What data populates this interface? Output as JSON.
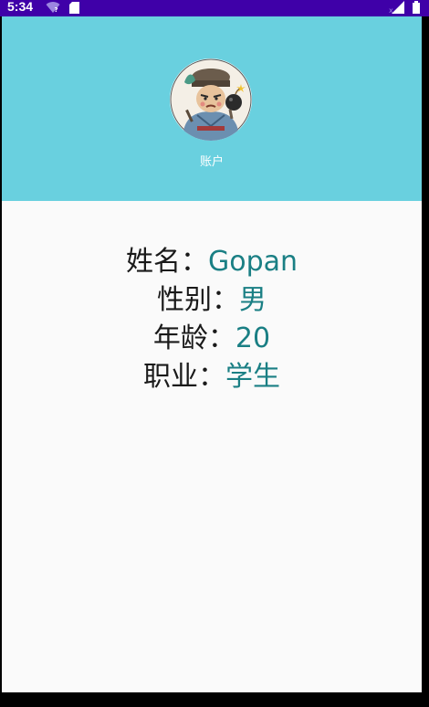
{
  "status_bar": {
    "time": "5:34",
    "icons_left": [
      "wifi-question-icon",
      "sd-card-icon"
    ],
    "icons_right": [
      "signal-icon",
      "battery-icon"
    ]
  },
  "header": {
    "background_color": "#69d0df",
    "avatar_icon": "avatar-character-icon",
    "account_label": "账户"
  },
  "profile": {
    "name_label": "姓名：",
    "name_value": "Gopan",
    "gender_label": "性别：",
    "gender_value": "男",
    "age_label": "年龄：",
    "age_value": "20",
    "job_label": "职业：",
    "job_value": "学生"
  },
  "colors": {
    "status_bar": "#3f00a8",
    "label_text": "#1a1a1a",
    "value_text": "#1a7f84",
    "page_background": "#fafafa"
  }
}
